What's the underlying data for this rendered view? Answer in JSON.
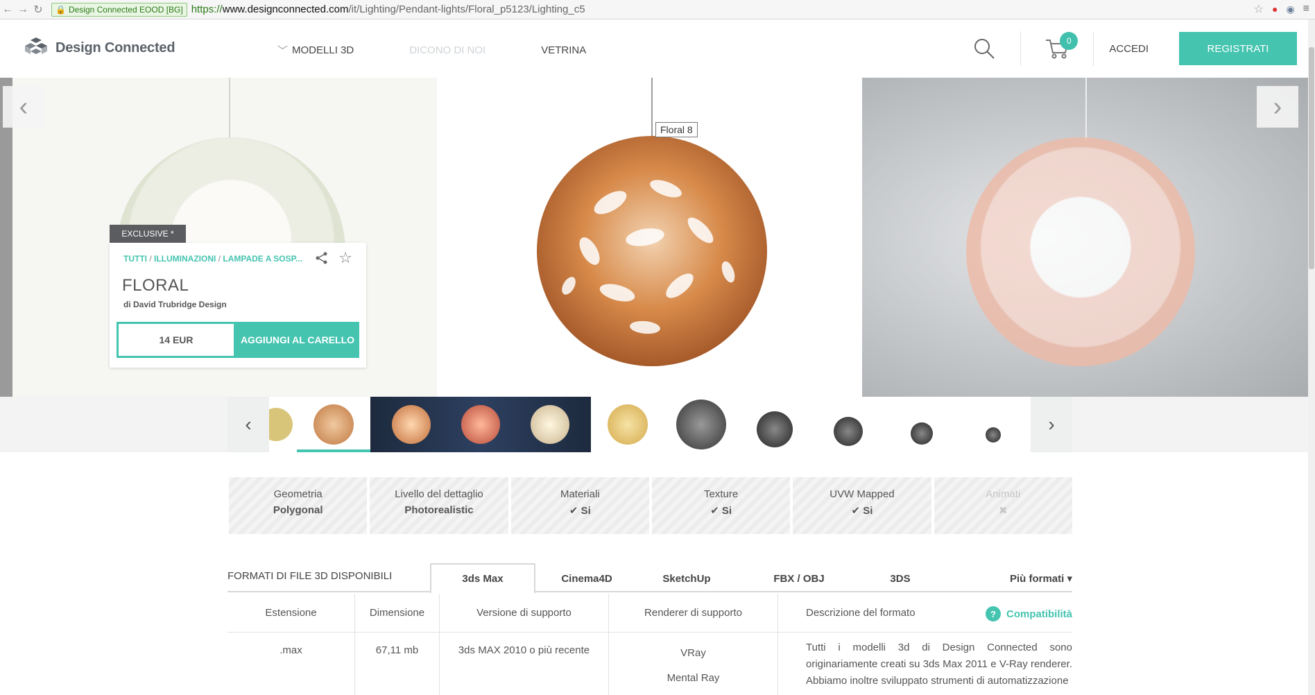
{
  "browser": {
    "ssl_label": "Design Connected EOOD [BG]",
    "url_scheme": "https://",
    "url_host": "www.designconnected.com",
    "url_path": "/it/Lighting/Pendant-lights/Floral_p5123/Lighting_c5"
  },
  "header": {
    "logo_text": "Design Connected",
    "nav": [
      {
        "label": "MODELLI 3D"
      },
      {
        "label": "DICONO DI NOI"
      },
      {
        "label": "VETRINA"
      }
    ],
    "cart_count": "0",
    "login_label": "ACCEDI",
    "register_label": "REGISTRATI"
  },
  "hero": {
    "tooltip": "Floral 8",
    "badge": "EXCLUSIVE *",
    "breadcrumb": [
      "TUTTI",
      "ILLUMINAZIONI",
      "LAMPADE A SOSP..."
    ],
    "title": "FLORAL",
    "author": "di David Trubridge Design",
    "price": "14 EUR",
    "add_to_cart": "AGGIUNGI AL CARELLO"
  },
  "specs": [
    {
      "label": "Geometria",
      "value": "Polygonal"
    },
    {
      "label": "Livello del dettaglio",
      "value": "Photorealistic"
    },
    {
      "label": "Materiali",
      "value": "✔ Si"
    },
    {
      "label": "Texture",
      "value": "✔ Si"
    },
    {
      "label": "UVW Mapped",
      "value": "✔ Si"
    },
    {
      "label": "Animati",
      "value": "✖"
    }
  ],
  "formats": {
    "title": "FORMATI DI FILE 3D DISPONIBILI",
    "tabs": [
      "3ds Max",
      "Cinema4D",
      "SketchUp",
      "FBX / OBJ",
      "3DS",
      "Più formati ▾"
    ],
    "active_tab": "3ds Max",
    "columns": {
      "ext": "Estensione",
      "size": "Dimensione",
      "version": "Versione di supporto",
      "renderer": "Renderer di supporto",
      "desc": "Descrizione del formato"
    },
    "compat_label": "Compatibilità",
    "row": {
      "ext": ".max",
      "size": "67,11 mb",
      "version": "3ds MAX 2010 o più recente",
      "renderer_1": "VRay",
      "renderer_2": "Mental Ray",
      "desc": "Tutti i modelli 3d di Design Connected sono originariamente creati su 3ds Max 2011 e V-Ray renderer. Abbiamo inoltre sviluppato strumenti di automatizzazione"
    }
  },
  "colors": {
    "accent": "#45c4b0",
    "lamp_copper": "#c97a3e"
  }
}
